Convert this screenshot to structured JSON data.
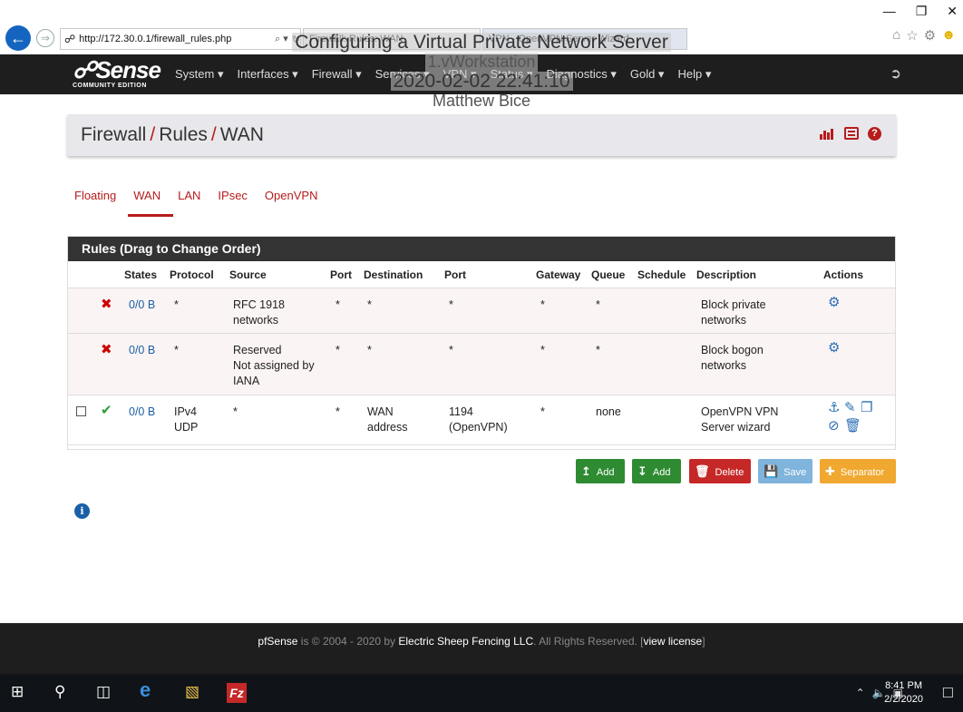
{
  "browser": {
    "url": "http://172.30.0.1/firewall_rules.php",
    "search_dropdown": "⌕ ▾",
    "refresh": "↻",
    "tab1_label": "Firewall: Rules: WAN",
    "tab2_label": "VPN - OpenVPN Server Wizard",
    "window_controls": [
      "—",
      "❐",
      "✕"
    ],
    "tool_icons": [
      "home-icon",
      "star-icon",
      "gear-icon",
      "smiley-icon"
    ]
  },
  "overlay": {
    "title": "Configuring a Virtual Private Network Server",
    "line2": "1.vWorkstation",
    "line3": "2020-02-02 22:41:10",
    "line4": "Matthew Bice"
  },
  "navbar": {
    "logo_main": "Sense",
    "logo_sub": "COMMUNITY EDITION",
    "menu": [
      "System ▾",
      "Interfaces ▾",
      "Firewall ▾",
      "Services ▾",
      "VPN ▾",
      "Status ▾",
      "Diagnostics ▾",
      "Gold ▾",
      "Help ▾"
    ]
  },
  "header": {
    "crumb1": "Firewall",
    "crumb2": "Rules",
    "crumb3": "WAN",
    "sep": "/"
  },
  "tabs": [
    "Floating",
    "WAN",
    "LAN",
    "IPsec",
    "OpenVPN"
  ],
  "rules": {
    "panel_title": "Rules (Drag to Change Order)",
    "columns": [
      "States",
      "Protocol",
      "Source",
      "Port",
      "Destination",
      "Port",
      "Gateway",
      "Queue",
      "Schedule",
      "Description",
      "Actions"
    ],
    "rows": [
      {
        "states": "0/0 B",
        "protocol": "*",
        "source": [
          "RFC 1918",
          "networks"
        ],
        "src_port": "*",
        "destination": "*",
        "dst_port": "*",
        "gateway": "*",
        "queue": "*",
        "schedule": "",
        "description": [
          "Block private",
          "networks"
        ]
      },
      {
        "states": "0/0 B",
        "protocol": "*",
        "source": [
          "Reserved",
          "Not assigned by",
          "IANA"
        ],
        "src_port": "*",
        "destination": "*",
        "dst_port": "*",
        "gateway": "*",
        "queue": "*",
        "schedule": "",
        "description": [
          "Block bogon",
          "networks"
        ]
      },
      {
        "states": "0/0 B",
        "protocol": [
          "IPv4",
          "UDP"
        ],
        "source": "*",
        "src_port": "*",
        "destination": [
          "WAN",
          "address"
        ],
        "dst_port": [
          "1194",
          "(OpenVPN)"
        ],
        "gateway": "*",
        "queue": "none",
        "schedule": "",
        "description": [
          "OpenVPN VPN",
          "Server wizard"
        ]
      }
    ]
  },
  "buttons": {
    "add_top": "Add",
    "add_bottom": "Add",
    "delete": "Delete",
    "save": "Save",
    "separator": "Separator"
  },
  "colors": {
    "add": "#2e8b32",
    "delete": "#c62828",
    "save": "#7fb4dc",
    "separator": "#f0a830",
    "accent": "#b71c1c"
  },
  "footer": {
    "brand": "pfSense",
    "text1": " is © 2004 - 2020 by ",
    "company": "Electric Sheep Fencing LLC",
    "text2": ". All Rights Reserved. [",
    "license": "view license",
    "text3": "]"
  },
  "taskbar": {
    "time": "8:41 PM",
    "date": "2/2/2020"
  }
}
